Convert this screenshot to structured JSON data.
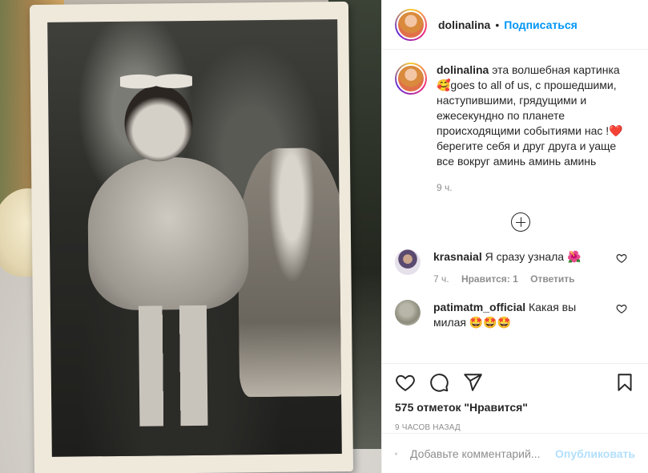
{
  "post": {
    "author": "dolinalina",
    "dot": "•",
    "follow_label": "Подписаться"
  },
  "caption": {
    "username": "dolinalina",
    "text": "эта волшебная картинка 🥰goes to all of us, с прошедшими, наступившими, грядущими и ежесекундно по планете происходящими событиями нас !❤️ берегите себя и друг друга и уаще все вокруг аминь аминь аминь",
    "time": "9 ч."
  },
  "comments": [
    {
      "username": "krasnaial",
      "text": "Я сразу узнала 🌺",
      "time": "7 ч.",
      "likes": "Нравится: 1",
      "reply": "Ответить"
    },
    {
      "username": "patimatm_official",
      "text": "Какая вы милая 🤩🤩🤩"
    }
  ],
  "stats": {
    "likes": "575 отметок \"Нравится\"",
    "time": "9 часов назад"
  },
  "comment_box": {
    "placeholder": "Добавьте комментарий...",
    "publish_label": "Опубликовать"
  },
  "colors": {
    "accent": "#0095f6",
    "publish_disabled": "#b2dffc",
    "muted": "#8e8e8e"
  }
}
